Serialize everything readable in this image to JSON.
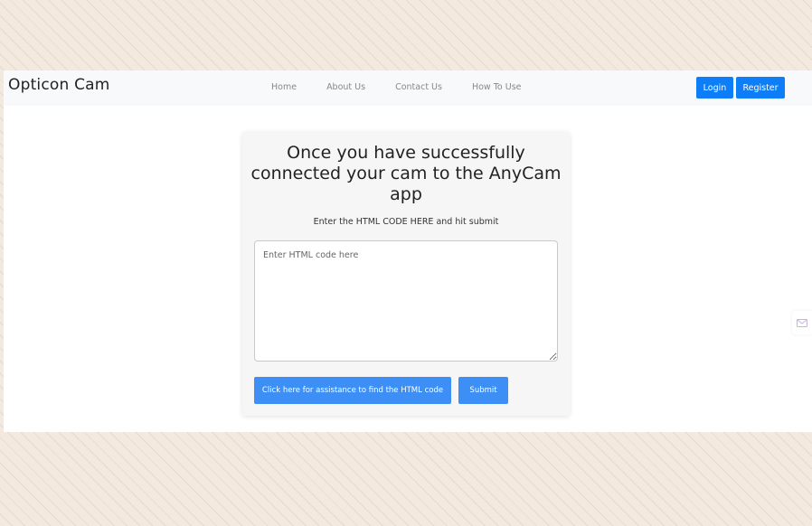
{
  "navbar": {
    "brand": "Opticon Cam",
    "links": [
      "Home",
      "About Us",
      "Contact Us",
      "How To Use"
    ],
    "login_label": "Login",
    "register_label": "Register"
  },
  "card": {
    "title": "Once you have successfully connected your cam to the AnyCam app",
    "subtitle": "Enter the HTML CODE HERE and hit submit",
    "textarea_placeholder": "Enter HTML code here",
    "assist_button": "Click here for assistance to find the HTML code",
    "submit_button": "Submit"
  },
  "colors": {
    "primary": "#0d7ef7",
    "button_light": "#3d8ff5",
    "page_background": "#f3e9df"
  },
  "icons": {
    "side_widget": "mail-icon"
  }
}
